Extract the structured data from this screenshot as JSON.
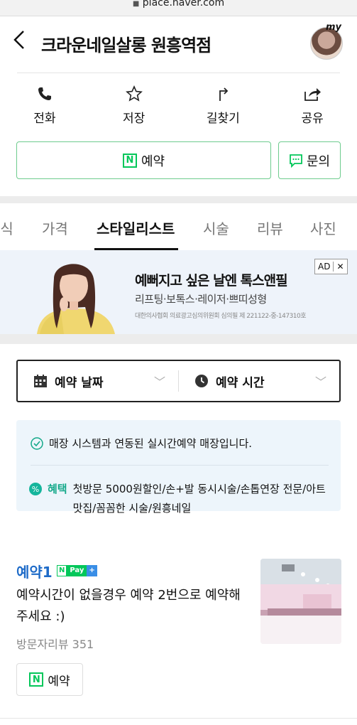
{
  "browser": {
    "url": "place.naver.com"
  },
  "header": {
    "title": "크라운네일살롱 원흥역점",
    "avatar_text": "my"
  },
  "actions": [
    {
      "label": "전화",
      "icon": "phone-icon"
    },
    {
      "label": "저장",
      "icon": "star-icon"
    },
    {
      "label": "길찾기",
      "icon": "directions-icon"
    },
    {
      "label": "공유",
      "icon": "share-icon"
    }
  ],
  "buttons": {
    "reserve_label": "예약",
    "inquiry_label": "문의",
    "n_mark": "N"
  },
  "tabs": [
    "소식",
    "가격",
    "스타일리스트",
    "시술",
    "리뷰",
    "사진"
  ],
  "active_tab": "스타일리스트",
  "ad": {
    "headline": "예뻐지고 싶은 날엔 톡스앤필",
    "subline": "리프팅·보톡스·레이저·쁘띠성형",
    "disclaimer": "대한의사협회 의료광고심의위원회 심의필 제 221122-중-147310호",
    "badge": "AD",
    "close": "✕"
  },
  "picker": {
    "date_label": "예약 날짜",
    "time_label": "예약 시간",
    "chevron": "﹀"
  },
  "info": {
    "realtime": "매장 시스템과 연동된 실시간예약 매장입니다.",
    "benefit_label": "혜택",
    "benefit_text": "첫방문 5000원할인/손+발 동시시술/손톱연장 전문/아트 맛집/꼼꼼한 시술/원흥네일"
  },
  "service": {
    "name": "예약1",
    "npay": {
      "n": "N",
      "pay": "Pay",
      "plus": "+"
    },
    "description": "예약시간이 없을경우 예약 2번으로 예약해주세요 :)",
    "reviews": "방문자리뷰 351",
    "button_label": "예약"
  },
  "colors": {
    "naver_green": "#03c75a",
    "link_blue": "#1e6bc8",
    "benefit_teal": "#13a889"
  }
}
